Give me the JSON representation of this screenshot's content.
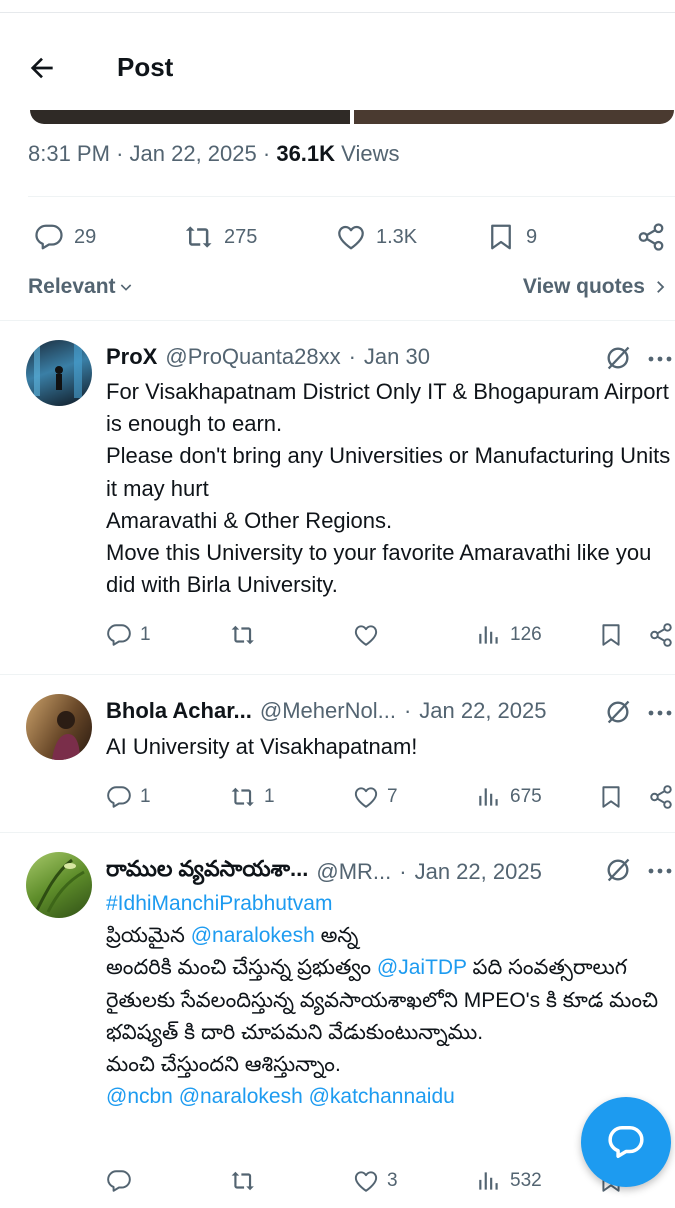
{
  "header": {
    "title": "Post"
  },
  "post": {
    "time": "8:31 PM",
    "date": "Jan 22, 2025",
    "views_count": "36.1K",
    "views_label": "Views",
    "actions": {
      "replies": "29",
      "reposts": "275",
      "likes": "1.3K",
      "bookmarks": "9"
    }
  },
  "sort": {
    "label": "Relevant",
    "view_quotes": "View quotes"
  },
  "replies": [
    {
      "name": "ProX",
      "handle": "@ProQuanta28xx",
      "date": "Jan 30",
      "text": "For Visakhapatnam District Only IT & Bhogapuram Airport is enough to earn.\nPlease don't bring any Universities  or Manufacturing Units  it may hurt\nAmaravathi  & Other Regions.\nMove this University to your favorite Amaravathi like you did with Birla University.",
      "replies": "1",
      "reposts": "",
      "likes": "",
      "views": "126"
    },
    {
      "name": "Bhola Achar...",
      "handle": "@MeherNol...",
      "date": "Jan 22, 2025",
      "text": "AI University at Visakhapatnam!",
      "replies": "1",
      "reposts": "1",
      "likes": "7",
      "views": "675"
    },
    {
      "name": "రాముల వ్యవసాయశా...",
      "handle": "@MR...",
      "date": "Jan 22, 2025",
      "hashtag": "#IdhiManchiPrabhutvam",
      "text_a": "ప్రియమైన ",
      "mention_a": "@naralokesh",
      "text_b": " అన్న\nఅందరికి మంచి చేస్తున్న ప్రభుత్వం ",
      "mention_b": "@JaiTDP",
      "text_c": " పది సంవత్సరాలుగ రైతులకు సేవలందిస్తున్న వ్యవసాయశాఖలోని MPEO's కి కూడ మంచి భవిష్యత్ కి దారి చూపమని వేడుకుంటున్నాము.\nమంచి చేస్తుందని ఆశిస్తున్నాం.",
      "mentions_end": "@ncbn @naralokesh @katchannaidu",
      "replies": "",
      "reposts": "",
      "likes": "3",
      "views": "532"
    }
  ],
  "colors": {
    "accent": "#1d9bf0",
    "muted": "#536471",
    "text": "#0f1419"
  },
  "icons": [
    "back-arrow-icon",
    "reply-icon",
    "repost-icon",
    "like-icon",
    "bookmark-icon",
    "share-icon",
    "chevron-down-icon",
    "chevron-right-icon",
    "grok-icon",
    "more-icon",
    "views-icon",
    "compose-reply-icon"
  ]
}
